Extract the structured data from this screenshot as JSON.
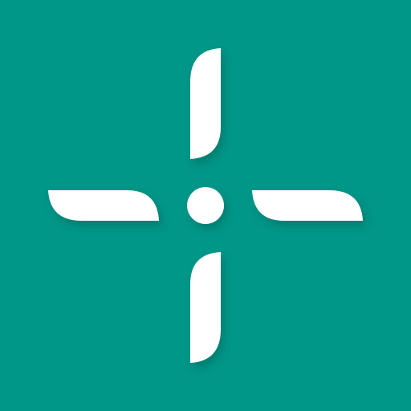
{
  "icon": {
    "name": "crosshair-target-icon",
    "background_color": "#009688",
    "foreground_color": "#FFFFFF",
    "shadow_color": "#004D40"
  }
}
